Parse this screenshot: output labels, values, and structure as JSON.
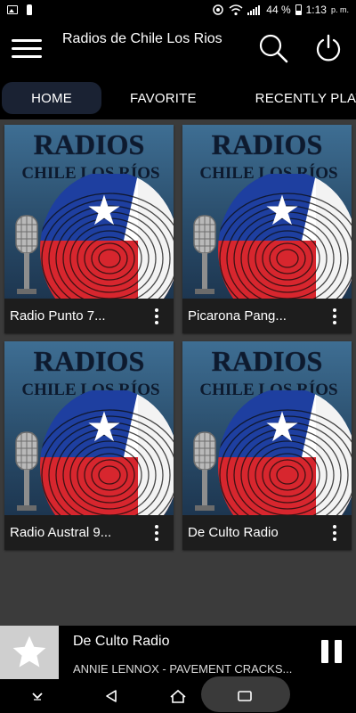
{
  "status_bar": {
    "battery": "44 %",
    "time": "1:13",
    "ampm": "p. m."
  },
  "app_bar": {
    "title": "Radios de Chile Los Rios"
  },
  "tabs": [
    {
      "label": "HOME",
      "active": true
    },
    {
      "label": "FAVORITE",
      "active": false
    },
    {
      "label": "RECENTLY PLAYED",
      "active": false
    }
  ],
  "stations": [
    {
      "name": "Radio Punto 7..."
    },
    {
      "name": "Picarona Pang..."
    },
    {
      "name": "Radio Austral 9..."
    },
    {
      "name": "De Culto Radio"
    }
  ],
  "artwork": {
    "line1": "RADIOS",
    "line2": "CHILE LOS RÍOS"
  },
  "player": {
    "title": "De Culto Radio",
    "subtitle": "ANNIE LENNOX - PAVEMENT CRACKS..."
  },
  "colors": {
    "background": "#3b3b3b",
    "bar": "#000000",
    "active_tab": "#1a2233",
    "card": "#1d1d1d"
  }
}
